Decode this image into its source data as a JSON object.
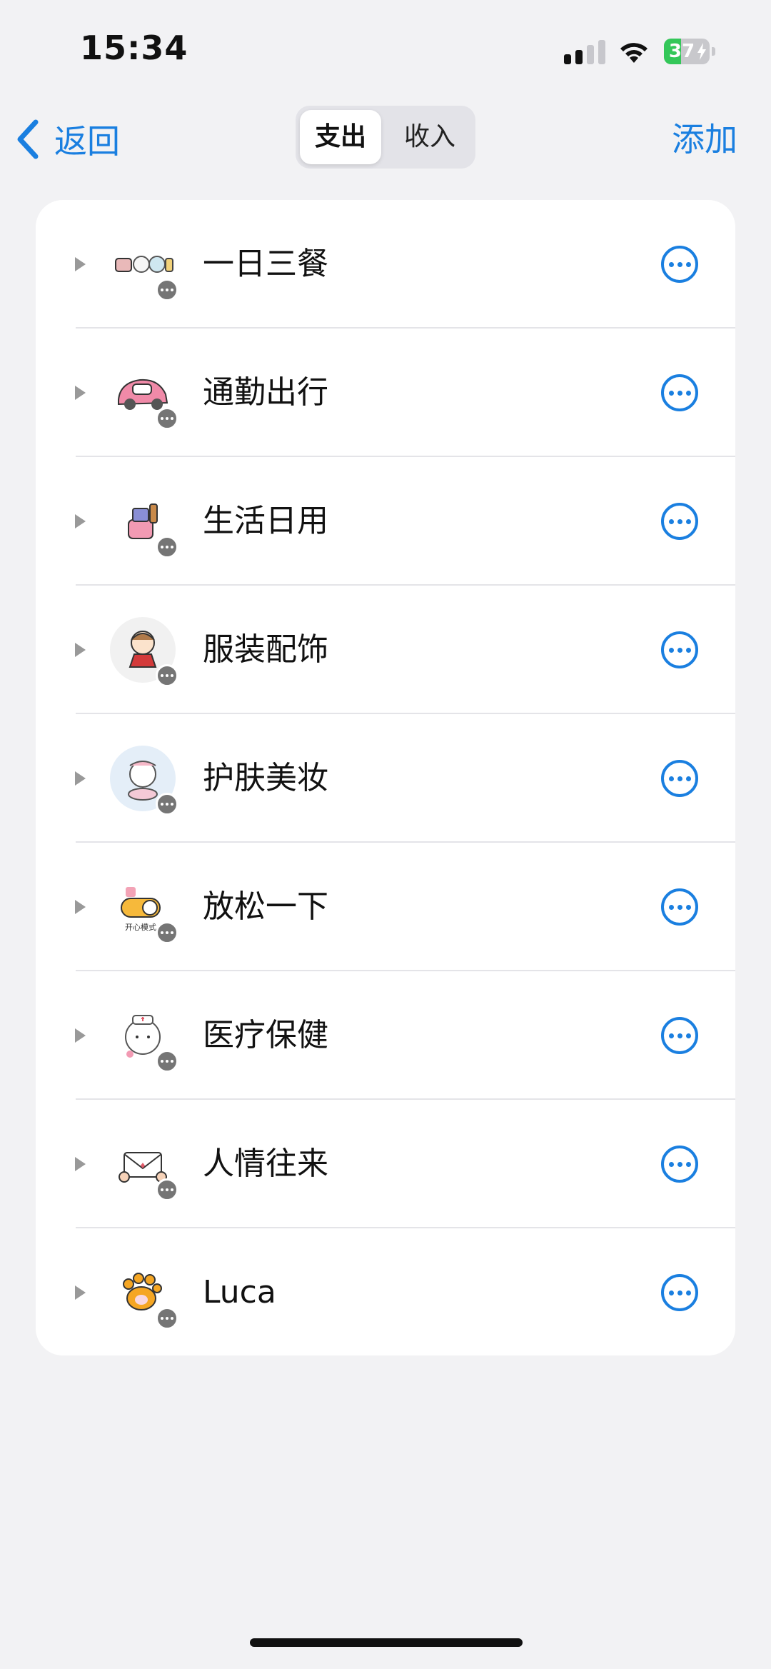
{
  "status_bar": {
    "time": "15:34",
    "battery_percent": "37",
    "battery_level": 0.37,
    "signal_bars_active": 2,
    "signal_bars_total": 4
  },
  "nav": {
    "back_label": "返回",
    "segments": [
      {
        "label": "支出",
        "selected": true
      },
      {
        "label": "收入",
        "selected": false
      }
    ],
    "add_label": "添加"
  },
  "colors": {
    "accent": "#1a7fe0",
    "background": "#f2f2f4",
    "card": "#ffffff",
    "badge": "#757575",
    "battery_fill": "#34c759"
  },
  "categories": [
    {
      "label": "一日三餐",
      "icon": "meal-sticker-icon"
    },
    {
      "label": "通勤出行",
      "icon": "pink-car-sticker-icon"
    },
    {
      "label": "生活日用",
      "icon": "daily-goods-sticker-icon"
    },
    {
      "label": "服装配饰",
      "icon": "girl-clothing-sticker-icon"
    },
    {
      "label": "护肤美妆",
      "icon": "cat-beauty-sticker-icon"
    },
    {
      "label": "放松一下",
      "icon": "relax-toggle-sticker-icon",
      "icon_text": "开心模式"
    },
    {
      "label": "医疗保健",
      "icon": "nurse-bunny-sticker-icon"
    },
    {
      "label": "人情往来",
      "icon": "envelope-sticker-icon"
    },
    {
      "label": "Luca",
      "icon": "paw-sticker-icon"
    }
  ]
}
